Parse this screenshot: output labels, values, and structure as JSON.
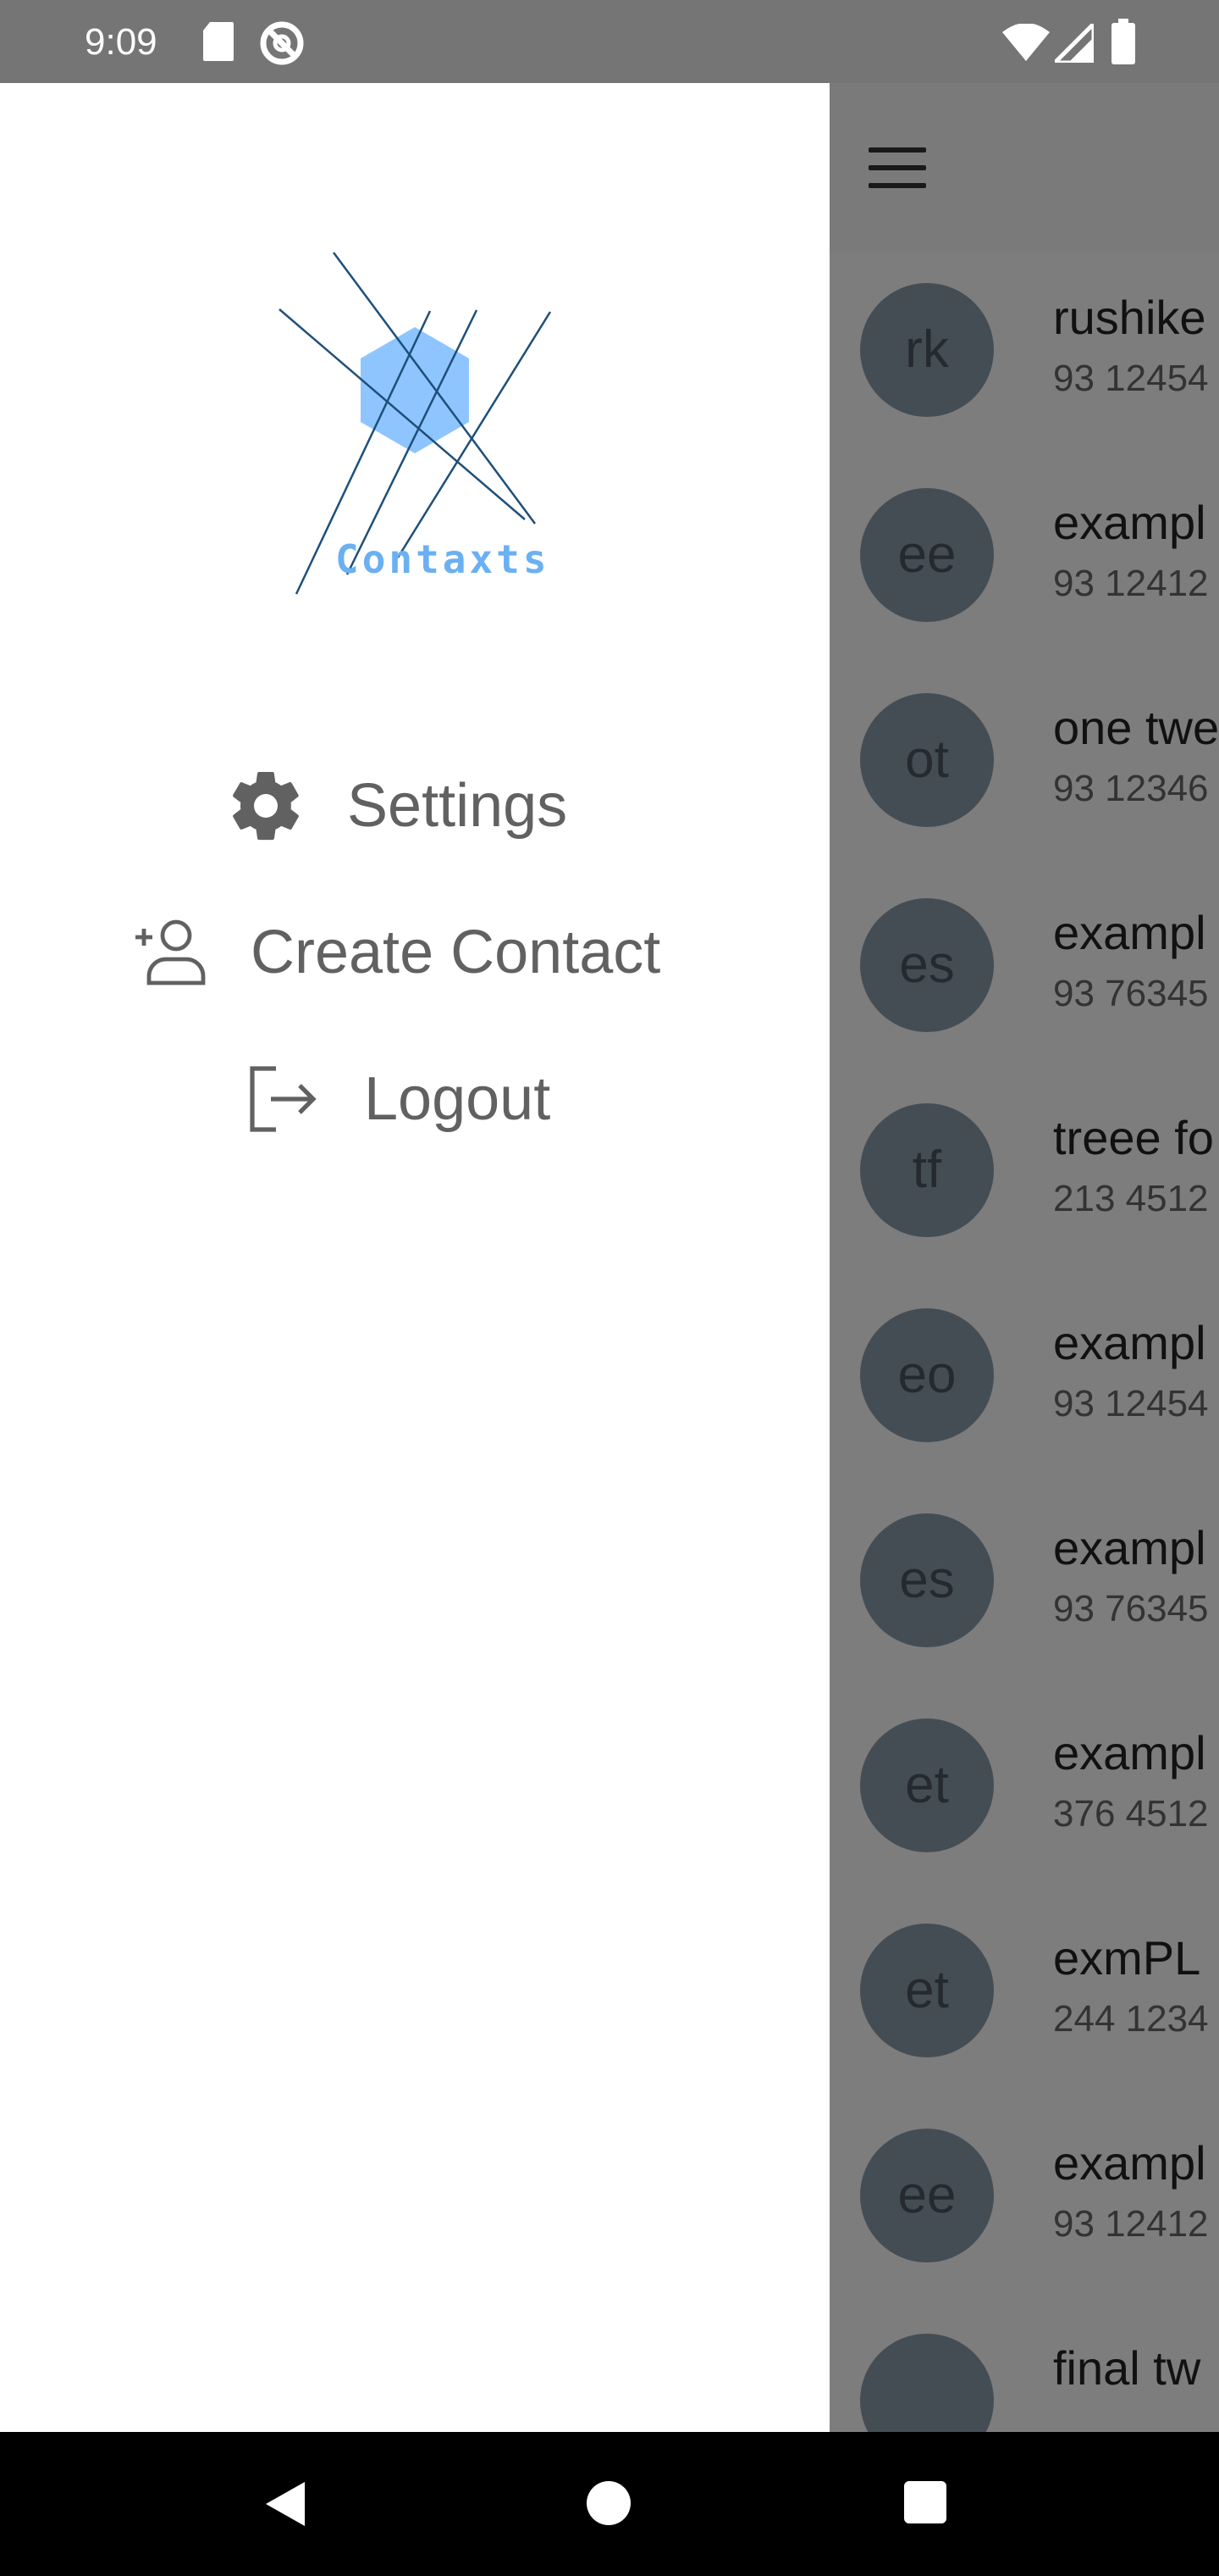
{
  "status_bar": {
    "time": "9:09",
    "icons": [
      "sd-card-icon",
      "do-not-disturb-icon",
      "wifi-icon",
      "signal-icon",
      "battery-icon"
    ]
  },
  "app": {
    "menu_icon": "menu-icon",
    "contacts": [
      {
        "initials": "rk",
        "name": "rushike",
        "phone": "93 12454"
      },
      {
        "initials": "ee",
        "name": "exampl",
        "phone": "93 12412"
      },
      {
        "initials": "ot",
        "name": "one twe",
        "phone": "93 12346"
      },
      {
        "initials": "es",
        "name": "exampl",
        "phone": "93 76345"
      },
      {
        "initials": "tf",
        "name": "treee fo",
        "phone": "213 4512"
      },
      {
        "initials": "eo",
        "name": "exampl",
        "phone": "93 12454"
      },
      {
        "initials": "es",
        "name": "exampl",
        "phone": "93 76345"
      },
      {
        "initials": "et",
        "name": "exampl",
        "phone": "376 4512"
      },
      {
        "initials": "et",
        "name": "exmPL",
        "phone": "244 1234"
      },
      {
        "initials": "ee",
        "name": "exampl",
        "phone": "93 12412"
      },
      {
        "initials": "",
        "name": "final tw",
        "phone": ""
      }
    ]
  },
  "drawer": {
    "logo_text": "Contaxts",
    "items": [
      {
        "label": "Settings",
        "icon": "gear-icon"
      },
      {
        "label": "Create Contact",
        "icon": "add-person-icon"
      },
      {
        "label": "Logout",
        "icon": "logout-icon"
      }
    ]
  },
  "nav_bar": {
    "buttons": [
      "back-icon",
      "home-icon",
      "recents-icon"
    ]
  },
  "colors": {
    "status_bar": "#757575",
    "scrim": "rgba(0,0,0,0.5)",
    "drawer_bg": "#ffffff",
    "drawer_text": "#616161",
    "logo_blue": "#6ab0f3",
    "nav_bar": "#000000"
  }
}
